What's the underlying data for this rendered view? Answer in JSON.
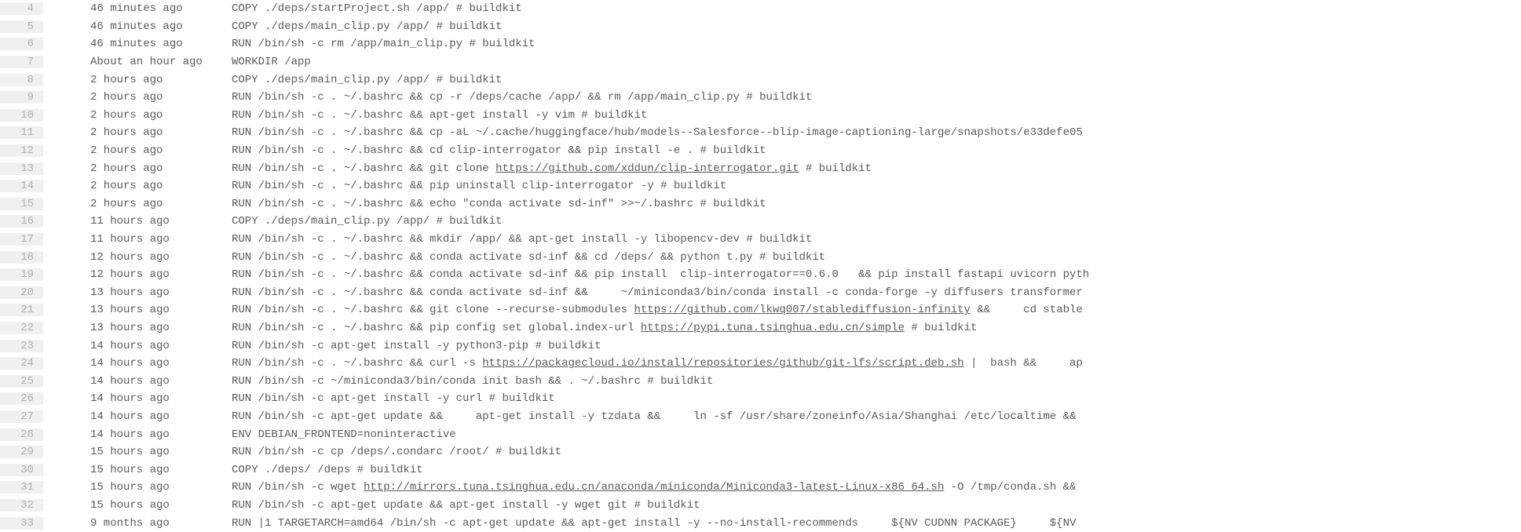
{
  "lines": [
    {
      "num": 4,
      "age": "46 minutes ago",
      "cmd": "COPY ./deps/startProject.sh /app/ # buildkit"
    },
    {
      "num": 5,
      "age": "46 minutes ago",
      "cmd": "COPY ./deps/main_clip.py /app/ # buildkit"
    },
    {
      "num": 6,
      "age": "46 minutes ago",
      "cmd": "RUN /bin/sh -c rm /app/main_clip.py # buildkit"
    },
    {
      "num": 7,
      "age": "About an hour ago",
      "cmd": "WORKDIR /app"
    },
    {
      "num": 8,
      "age": "2 hours ago",
      "cmd": "COPY ./deps/main_clip.py /app/ # buildkit"
    },
    {
      "num": 9,
      "age": "2 hours ago",
      "cmd": "RUN /bin/sh -c . ~/.bashrc && cp -r /deps/cache /app/ && rm /app/main_clip.py # buildkit"
    },
    {
      "num": 10,
      "age": "2 hours ago",
      "cmd": "RUN /bin/sh -c . ~/.bashrc && apt-get install -y vim # buildkit"
    },
    {
      "num": 11,
      "age": "2 hours ago",
      "cmd": "RUN /bin/sh -c . ~/.bashrc && cp -aL ~/.cache/huggingface/hub/models--Salesforce--blip-image-captioning-large/snapshots/e33defe05"
    },
    {
      "num": 12,
      "age": "2 hours ago",
      "cmd": "RUN /bin/sh -c . ~/.bashrc && cd clip-interrogator && pip install -e . # buildkit"
    },
    {
      "num": 13,
      "age": "2 hours ago",
      "cmd": "RUN /bin/sh -c . ~/.bashrc && git clone ",
      "link": "https://github.com/xddun/clip-interrogator.git",
      "after": " # buildkit"
    },
    {
      "num": 14,
      "age": "2 hours ago",
      "cmd": "RUN /bin/sh -c . ~/.bashrc && pip uninstall clip-interrogator -y # buildkit"
    },
    {
      "num": 15,
      "age": "2 hours ago",
      "cmd": "RUN /bin/sh -c . ~/.bashrc && echo \"conda activate sd-inf\" >>~/.bashrc # buildkit"
    },
    {
      "num": 16,
      "age": "11 hours ago",
      "cmd": "COPY ./deps/main_clip.py /app/ # buildkit"
    },
    {
      "num": 17,
      "age": "11 hours ago",
      "cmd": "RUN /bin/sh -c . ~/.bashrc && mkdir /app/ && apt-get install -y libopencv-dev # buildkit"
    },
    {
      "num": 18,
      "age": "12 hours ago",
      "cmd": "RUN /bin/sh -c . ~/.bashrc && conda activate sd-inf && cd /deps/ && python t.py # buildkit"
    },
    {
      "num": 19,
      "age": "12 hours ago",
      "cmd": "RUN /bin/sh -c . ~/.bashrc && conda activate sd-inf && pip install  clip-interrogator==0.6.0   && pip install fastapi uvicorn pyth"
    },
    {
      "num": 20,
      "age": "13 hours ago",
      "cmd": "RUN /bin/sh -c . ~/.bashrc && conda activate sd-inf &&     ~/miniconda3/bin/conda install -c conda-forge -y diffusers transformer"
    },
    {
      "num": 21,
      "age": "13 hours ago",
      "cmd": "RUN /bin/sh -c . ~/.bashrc && git clone --recurse-submodules ",
      "link": "https://github.com/lkwq007/stablediffusion-infinity",
      "after": " &&     cd stable"
    },
    {
      "num": 22,
      "age": "13 hours ago",
      "cmd": "RUN /bin/sh -c . ~/.bashrc && pip config set global.index-url ",
      "link": "https://pypi.tuna.tsinghua.edu.cn/simple",
      "after": " # buildkit"
    },
    {
      "num": 23,
      "age": "14 hours ago",
      "cmd": "RUN /bin/sh -c apt-get install -y python3-pip # buildkit"
    },
    {
      "num": 24,
      "age": "14 hours ago",
      "cmd": "RUN /bin/sh -c . ~/.bashrc && curl -s ",
      "link": "https://packagecloud.io/install/repositories/github/git-lfs/script.deb.sh",
      "after": " |  bash &&     ap"
    },
    {
      "num": 25,
      "age": "14 hours ago",
      "cmd": "RUN /bin/sh -c ~/miniconda3/bin/conda init bash && . ~/.bashrc # buildkit"
    },
    {
      "num": 26,
      "age": "14 hours ago",
      "cmd": "RUN /bin/sh -c apt-get install -y curl # buildkit"
    },
    {
      "num": 27,
      "age": "14 hours ago",
      "cmd": "RUN /bin/sh -c apt-get update &&     apt-get install -y tzdata &&     ln -sf /usr/share/zoneinfo/Asia/Shanghai /etc/localtime && "
    },
    {
      "num": 28,
      "age": "14 hours ago",
      "cmd": "ENV DEBIAN_FRONTEND=noninteractive"
    },
    {
      "num": 29,
      "age": "15 hours ago",
      "cmd": "RUN /bin/sh -c cp /deps/.condarc /root/ # buildkit"
    },
    {
      "num": 30,
      "age": "15 hours ago",
      "cmd": "COPY ./deps/ /deps # buildkit"
    },
    {
      "num": 31,
      "age": "15 hours ago",
      "cmd": "RUN /bin/sh -c wget ",
      "link": "http://mirrors.tuna.tsinghua.edu.cn/anaconda/miniconda/Miniconda3-latest-Linux-x86_64.sh",
      "after": " -O /tmp/conda.sh && "
    },
    {
      "num": 32,
      "age": "15 hours ago",
      "cmd": "RUN /bin/sh -c apt-get update && apt-get install -y wget git # buildkit"
    },
    {
      "num": 33,
      "age": "9 months ago",
      "cmd": "RUN |1 TARGETARCH=amd64 /bin/sh -c apt-get update && apt-get install -y --no-install-recommends     ${NV CUDNN PACKAGE}     ${NV"
    }
  ]
}
